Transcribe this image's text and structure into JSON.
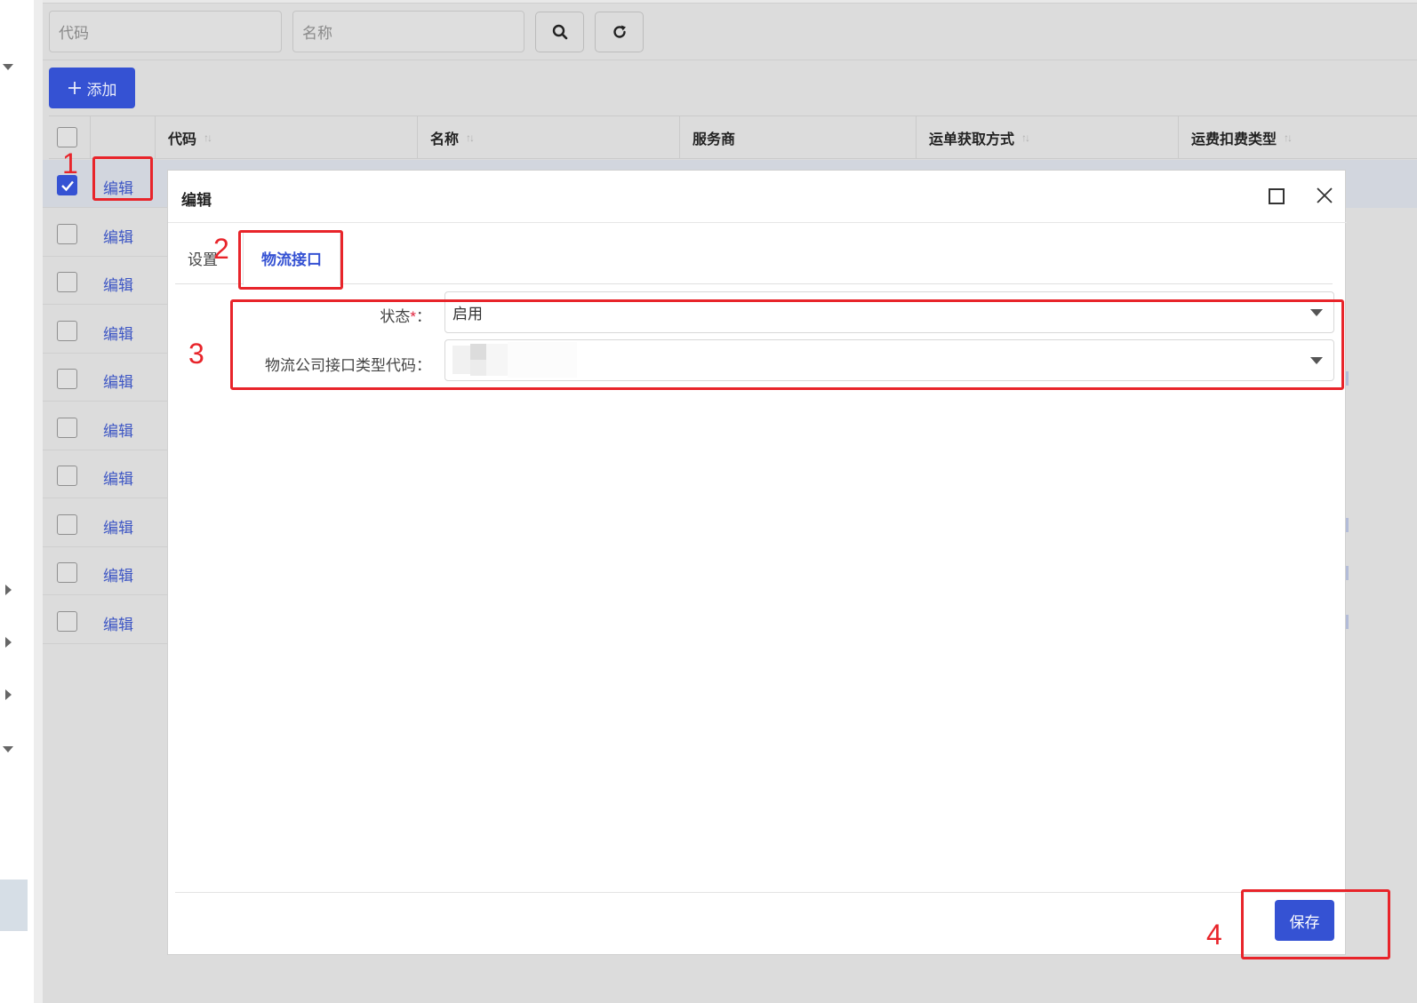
{
  "search": {
    "code_placeholder": "代码",
    "name_placeholder": "名称",
    "search_icon": "search-icon",
    "refresh_icon": "refresh-icon"
  },
  "toolbar": {
    "add_label": "添加"
  },
  "table": {
    "columns": [
      "代码",
      "名称",
      "服务商",
      "运单获取方式",
      "运费扣费类型"
    ],
    "rows": [
      {
        "edit_label": "编辑",
        "checked": true
      },
      {
        "edit_label": "编辑",
        "checked": false
      },
      {
        "edit_label": "编辑",
        "checked": false
      },
      {
        "edit_label": "编辑",
        "checked": false
      },
      {
        "edit_label": "编辑",
        "checked": false
      },
      {
        "edit_label": "编辑",
        "checked": false
      },
      {
        "edit_label": "编辑",
        "checked": false
      },
      {
        "edit_label": "编辑",
        "checked": false
      },
      {
        "edit_label": "编辑",
        "checked": false
      },
      {
        "edit_label": "编辑",
        "checked": false
      }
    ]
  },
  "dialog": {
    "title": "编辑",
    "tabs": [
      {
        "label": "设置",
        "active": false
      },
      {
        "label": "物流接口",
        "active": true
      }
    ],
    "form": {
      "status_label": "状态",
      "status_required": "*",
      "status_colon": "：",
      "status_value": "启用",
      "interface_label": "物流公司接口类型代码：",
      "interface_value": ""
    },
    "save_label": "保存"
  },
  "annotations": [
    "1",
    "2",
    "3",
    "4"
  ],
  "colors": {
    "primary": "#3552d3",
    "annotation": "#e8242a",
    "link": "#3d56c4",
    "required": "#e0203a"
  }
}
